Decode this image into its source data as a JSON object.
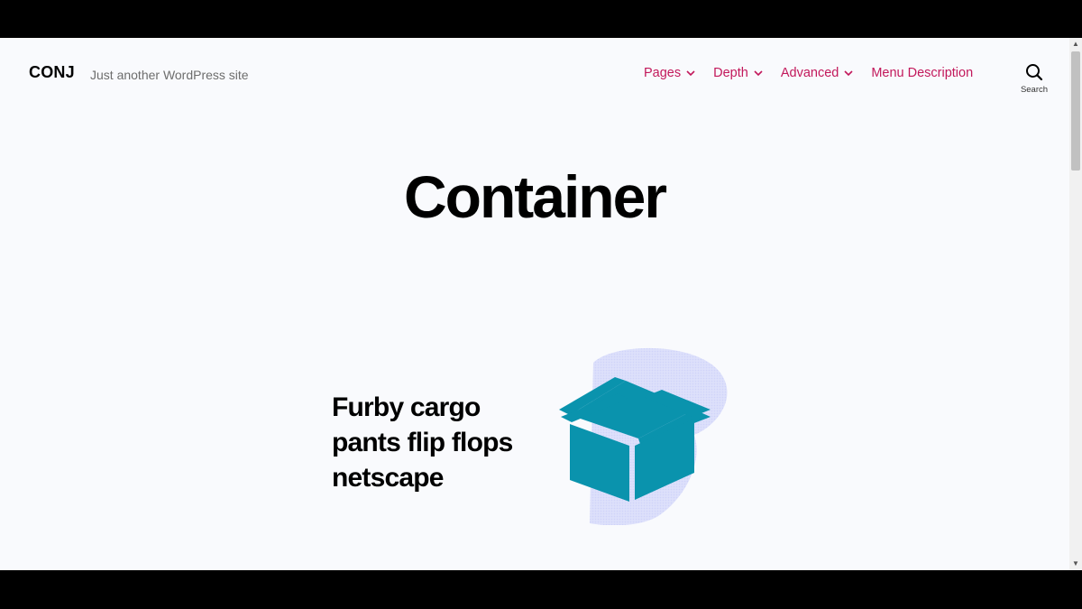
{
  "site": {
    "title": "CONJ",
    "tagline": "Just another WordPress site"
  },
  "nav": {
    "items": [
      {
        "label": "Pages",
        "has_submenu": true
      },
      {
        "label": "Depth",
        "has_submenu": true
      },
      {
        "label": "Advanced",
        "has_submenu": true
      },
      {
        "label": "Menu Description",
        "has_submenu": false
      }
    ],
    "search_label": "Search"
  },
  "page": {
    "title": "Container"
  },
  "container_block": {
    "heading": "Furby cargo pants flip flops netscape",
    "image_icon": "open-box-icon"
  },
  "colors": {
    "accent": "#c2185b",
    "background": "#f9fafd",
    "box": "#0a93ad",
    "blob": "#d9dcfb"
  }
}
